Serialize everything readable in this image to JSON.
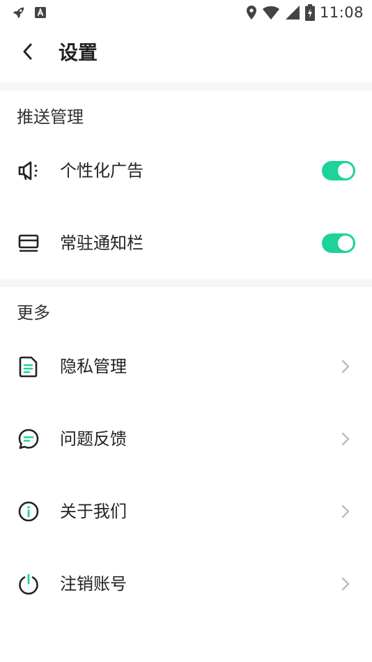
{
  "status_bar": {
    "time": "11:08",
    "icons_left": [
      "rocket-icon",
      "a-badge-icon"
    ],
    "icons_right": [
      "location-icon",
      "wifi-icon",
      "signal-icon",
      "battery-charging-icon"
    ]
  },
  "header": {
    "back_icon": "chevron-left-icon",
    "title": "设置"
  },
  "sections": {
    "push": {
      "title": "推送管理",
      "items": [
        {
          "label": "个性化广告",
          "icon": "megaphone-icon",
          "toggle_on": true
        },
        {
          "label": "常驻通知栏",
          "icon": "wallet-icon",
          "toggle_on": true
        }
      ]
    },
    "more": {
      "title": "更多",
      "items": [
        {
          "label": "隐私管理",
          "icon": "document-icon"
        },
        {
          "label": "问题反馈",
          "icon": "chat-bubble-icon"
        },
        {
          "label": "关于我们",
          "icon": "info-icon"
        },
        {
          "label": "注销账号",
          "icon": "power-icon"
        }
      ]
    }
  },
  "colors": {
    "accent": "#1ed39a",
    "text_primary": "#222222",
    "divider": "#f5f6f7",
    "chevron": "#b8bcc2"
  }
}
